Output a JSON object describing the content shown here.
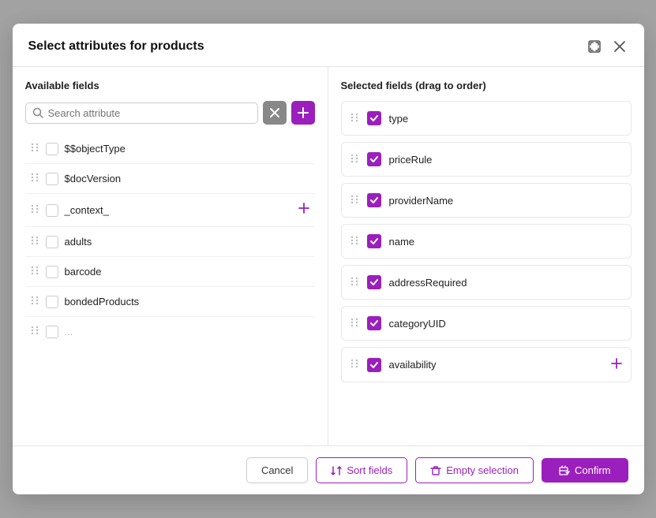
{
  "modal": {
    "title": "Select attributes for products",
    "left_panel_label": "Available fields",
    "right_panel_label": "Selected fields (drag to order)"
  },
  "search": {
    "placeholder": "Search attribute",
    "value": ""
  },
  "available_fields": [
    {
      "name": "$$objectType",
      "checked": false,
      "expandable": false
    },
    {
      "name": "$docVersion",
      "checked": false,
      "expandable": false
    },
    {
      "name": "_context_",
      "checked": false,
      "expandable": true
    },
    {
      "name": "adults",
      "checked": false,
      "expandable": false
    },
    {
      "name": "barcode",
      "checked": false,
      "expandable": false
    },
    {
      "name": "bondedProducts",
      "checked": false,
      "expandable": false
    },
    {
      "name": "...",
      "checked": false,
      "expandable": false
    }
  ],
  "selected_fields": [
    {
      "name": "type"
    },
    {
      "name": "priceRule"
    },
    {
      "name": "providerName"
    },
    {
      "name": "name"
    },
    {
      "name": "addressRequired"
    },
    {
      "name": "categoryUID"
    },
    {
      "name": "availability",
      "expandable": true
    }
  ],
  "buttons": {
    "cancel": "Cancel",
    "sort": "Sort fields",
    "empty": "Empty selection",
    "confirm": "Confirm"
  },
  "icons": {
    "expand": "⇅",
    "drag": "⠿",
    "check": "✓",
    "close": "✕",
    "sort_icon": "⇅",
    "trash_icon": "🗑",
    "save_icon": "💾"
  }
}
